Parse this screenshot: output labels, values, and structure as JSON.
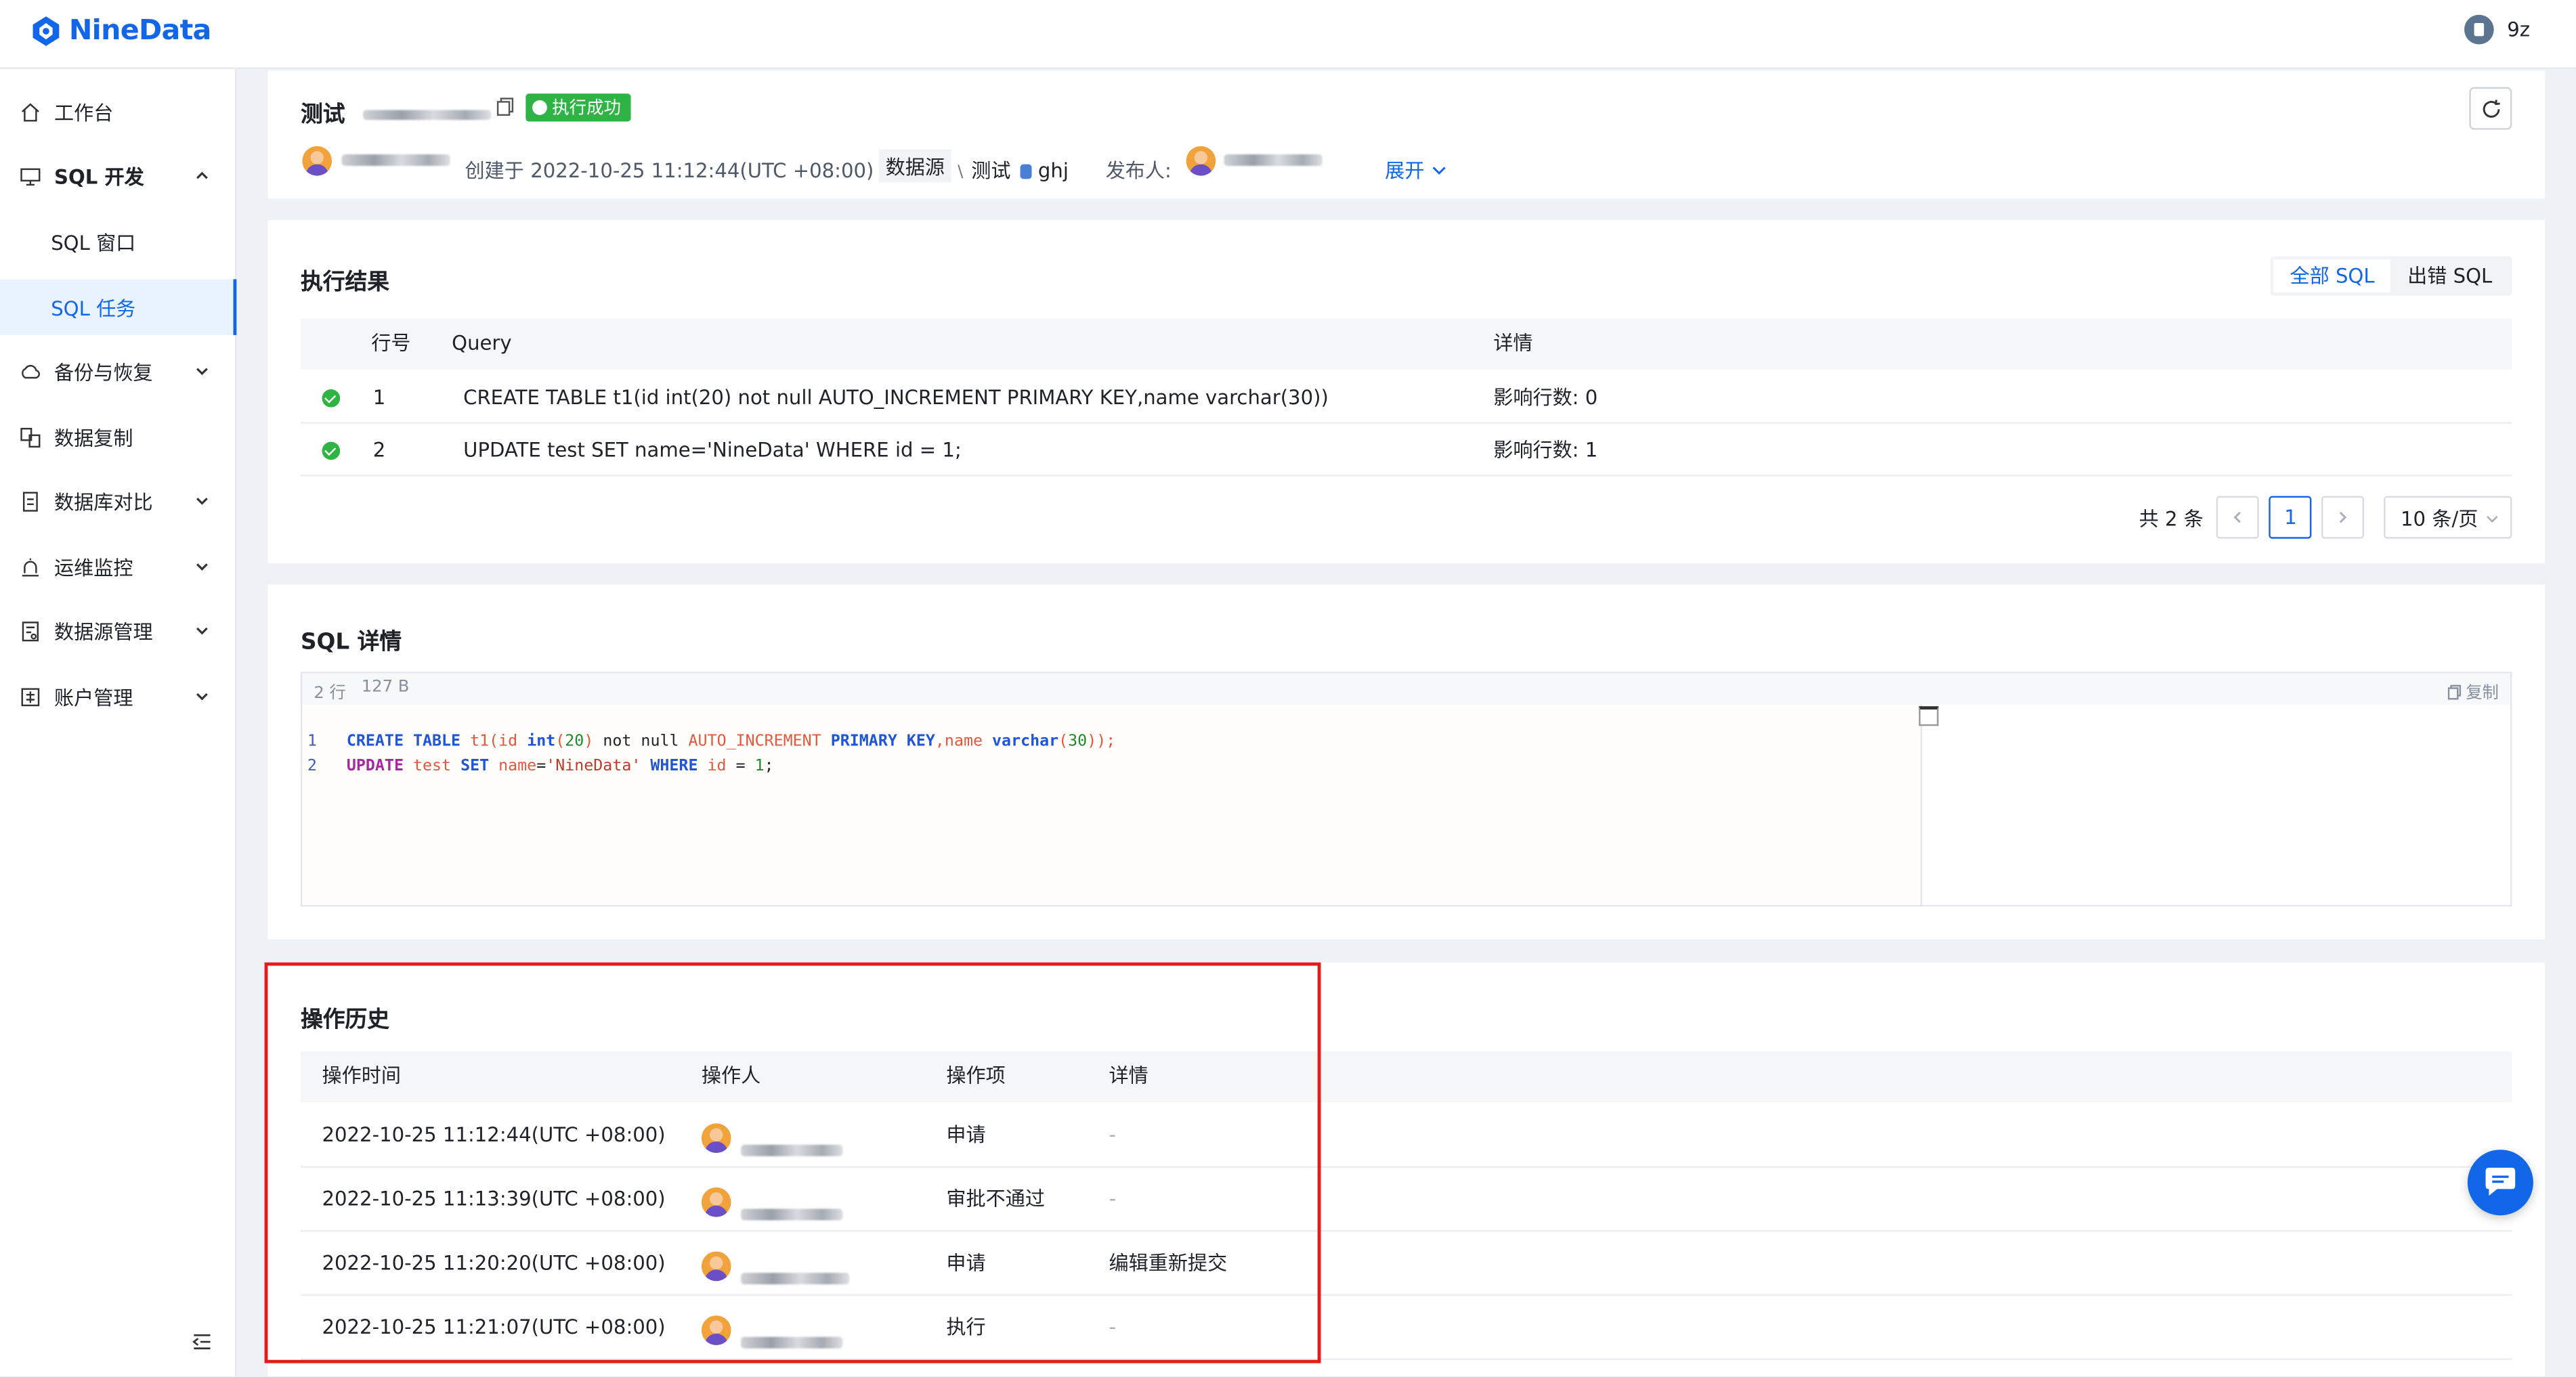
{
  "app": {
    "logo_text": "NineData",
    "user_name": "9z"
  },
  "sidebar": {
    "items": [
      {
        "label": "工作台",
        "icon": "home-icon"
      },
      {
        "label": "SQL 开发",
        "icon": "monitor-icon",
        "expanded": true
      },
      {
        "label": "SQL 窗口",
        "sub": true
      },
      {
        "label": "SQL 任务",
        "sub": true,
        "active": true
      },
      {
        "label": "备份与恢复",
        "icon": "cloud-icon"
      },
      {
        "label": "数据复制",
        "icon": "copy-db-icon"
      },
      {
        "label": "数据库对比",
        "icon": "compare-icon"
      },
      {
        "label": "运维监控",
        "icon": "alarm-icon"
      },
      {
        "label": "数据源管理",
        "icon": "datasource-icon"
      },
      {
        "label": "账户管理",
        "icon": "account-icon"
      }
    ]
  },
  "task": {
    "title": "测试",
    "status": "执行成功",
    "created_prefix": "创建于",
    "created_at": "2022-10-25 11:12:44(UTC +08:00)",
    "datasource_label": "数据源",
    "datasource_name": "测试",
    "database_name": "ghj",
    "publisher_label": "发布人:",
    "expand_label": "展开"
  },
  "results": {
    "title": "执行结果",
    "tabs": [
      "全部 SQL",
      "出错 SQL"
    ],
    "active_tab": "全部 SQL",
    "columns": [
      "行号",
      "Query",
      "详情"
    ],
    "rows": [
      {
        "row": "1",
        "query": "CREATE TABLE t1(id int(20) not null AUTO_INCREMENT PRIMARY KEY,name varchar(30))",
        "detail": "影响行数: 0"
      },
      {
        "row": "2",
        "query": "UPDATE test SET name='NineData' WHERE id = 1;",
        "detail": "影响行数: 1"
      }
    ],
    "total_label": "共 2 条",
    "current_page": "1",
    "page_size": "10 条/页"
  },
  "sql_detail": {
    "title": "SQL 详情",
    "line_count": "2 行",
    "size": "127 B",
    "copy_label": "复制"
  },
  "history": {
    "title": "操作历史",
    "columns": [
      "操作时间",
      "操作人",
      "操作项",
      "详情"
    ],
    "rows": [
      {
        "time": "2022-10-25 11:12:44(UTC +08:00)",
        "action": "申请",
        "detail": "-"
      },
      {
        "time": "2022-10-25 11:13:39(UTC +08:00)",
        "action": "审批不通过",
        "detail": "-"
      },
      {
        "time": "2022-10-25 11:20:20(UTC +08:00)",
        "action": "申请",
        "detail": "编辑重新提交"
      },
      {
        "time": "2022-10-25 11:21:07(UTC +08:00)",
        "action": "执行",
        "detail": "-"
      }
    ]
  },
  "colors": {
    "accent": "#1167e8",
    "success": "#2fb344",
    "highlight": "#e51b1b"
  }
}
